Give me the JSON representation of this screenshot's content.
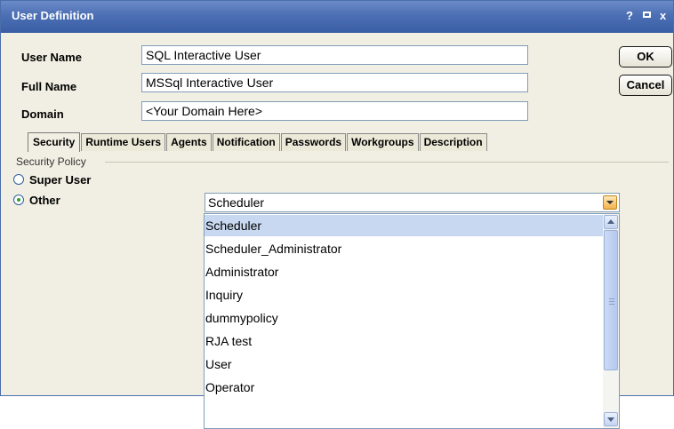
{
  "window": {
    "title": "User Definition",
    "help_glyph": "?",
    "maximize_glyph": "▫",
    "close_glyph": "x"
  },
  "form": {
    "user_name": {
      "label": "User Name",
      "value": "SQL Interactive User"
    },
    "full_name": {
      "label": "Full Name",
      "value": "MSSql Interactive User"
    },
    "domain": {
      "label": "Domain",
      "value": "<Your Domain Here>"
    }
  },
  "buttons": {
    "ok": "OK",
    "cancel": "Cancel"
  },
  "tabs": [
    "Security",
    "Runtime Users",
    "Agents",
    "Notification",
    "Passwords",
    "Workgroups",
    "Description"
  ],
  "active_tab": "Security",
  "security": {
    "group_label": "Security Policy",
    "super_user": "Super User",
    "other": "Other",
    "selected_option": "Other",
    "policy_selected": "Scheduler",
    "policy_options": [
      "Scheduler",
      "Scheduler_Administrator",
      "Administrator",
      "Inquiry",
      "dummypolicy",
      "RJA test",
      "User",
      "Operator"
    ]
  },
  "colors": {
    "titlebar": "#4c6fb4",
    "background": "#f1efe3",
    "selection": "#c7d8f0",
    "radio_dot": "#2aa52a"
  }
}
